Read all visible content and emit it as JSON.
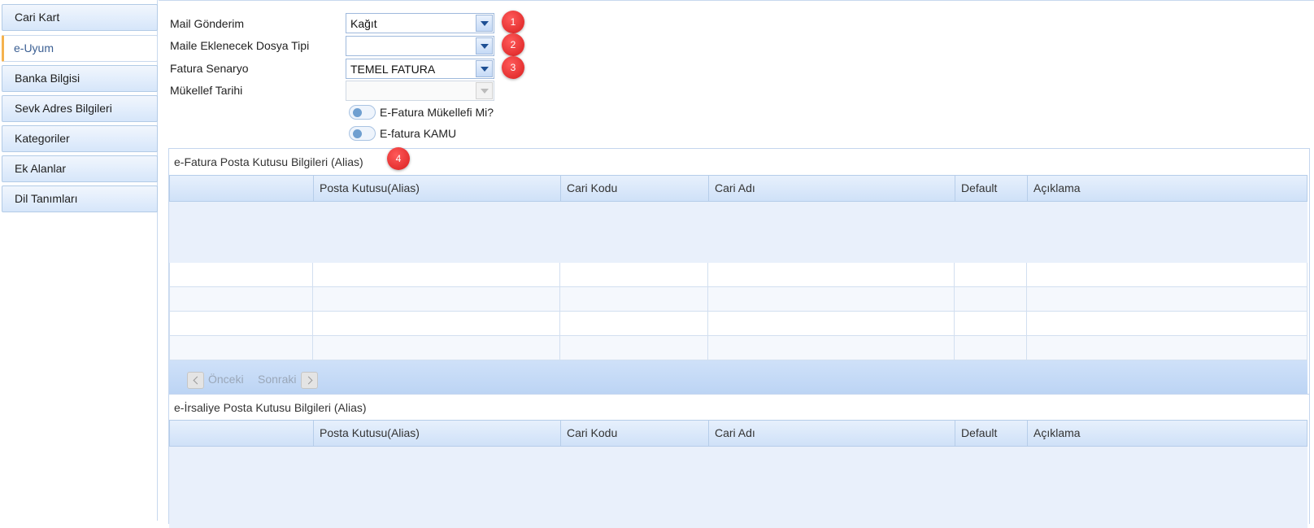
{
  "sidebar": {
    "items": [
      {
        "label": "Cari Kart"
      },
      {
        "label": "e-Uyum"
      },
      {
        "label": "Banka Bilgisi"
      },
      {
        "label": "Sevk Adres Bilgileri"
      },
      {
        "label": "Kategoriler"
      },
      {
        "label": "Ek Alanlar"
      },
      {
        "label": "Dil Tanımları"
      }
    ],
    "active_index": 1
  },
  "form": {
    "mail_gonderim": {
      "label": "Mail Gönderim",
      "value": "Kağıt",
      "badge": "1"
    },
    "dosya_tipi": {
      "label": "Maile Eklenecek Dosya Tipi",
      "value": "",
      "badge": "2"
    },
    "fatura_senaryo": {
      "label": "Fatura Senaryo",
      "value": "TEMEL FATURA",
      "badge": "3"
    },
    "mukellef_tarihi": {
      "label": "Mükellef Tarihi",
      "value": ""
    },
    "toggle_efatura": {
      "label": "E-Fatura Mükellefi Mi?",
      "checked": false
    },
    "toggle_kamu": {
      "label": "E-fatura KAMU",
      "checked": false
    }
  },
  "efatura_panel": {
    "title": "e-Fatura Posta Kutusu Bilgileri (Alias)",
    "badge": "4",
    "columns": [
      "",
      "Posta Kutusu(Alias)",
      "Cari Kodu",
      "Cari Adı",
      "Default",
      "Açıklama"
    ],
    "pager": {
      "prev": "Önceki",
      "next": "Sonraki"
    }
  },
  "eirsaliye_panel": {
    "title": "e-İrsaliye Posta Kutusu Bilgileri (Alias)",
    "columns": [
      "",
      "Posta Kutusu(Alias)",
      "Cari Kodu",
      "Cari Adı",
      "Default",
      "Açıklama"
    ]
  },
  "colors": {
    "accent": "#f5b24d",
    "badge": "#e02424",
    "header_bg": "#cfe1f8"
  }
}
